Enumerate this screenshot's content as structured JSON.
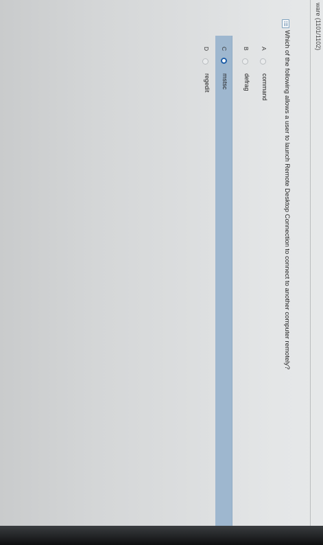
{
  "course": {
    "title": "ware (1101/1102)"
  },
  "question": {
    "text": "Which of the following allows a user to launch Remote Desktop Connection to connect to another computer remotely?"
  },
  "choices": [
    {
      "letter": "A",
      "label": "command",
      "selected": false
    },
    {
      "letter": "B",
      "label": "defrag",
      "selected": false
    },
    {
      "letter": "C",
      "label": "mstsc",
      "selected": true
    },
    {
      "letter": "D",
      "label": "regedit",
      "selected": false
    }
  ],
  "colors": {
    "selection_highlight": "#9eb7cf",
    "radio_selected": "#1f5fa8"
  },
  "icons": {
    "question": "question-list-icon"
  }
}
